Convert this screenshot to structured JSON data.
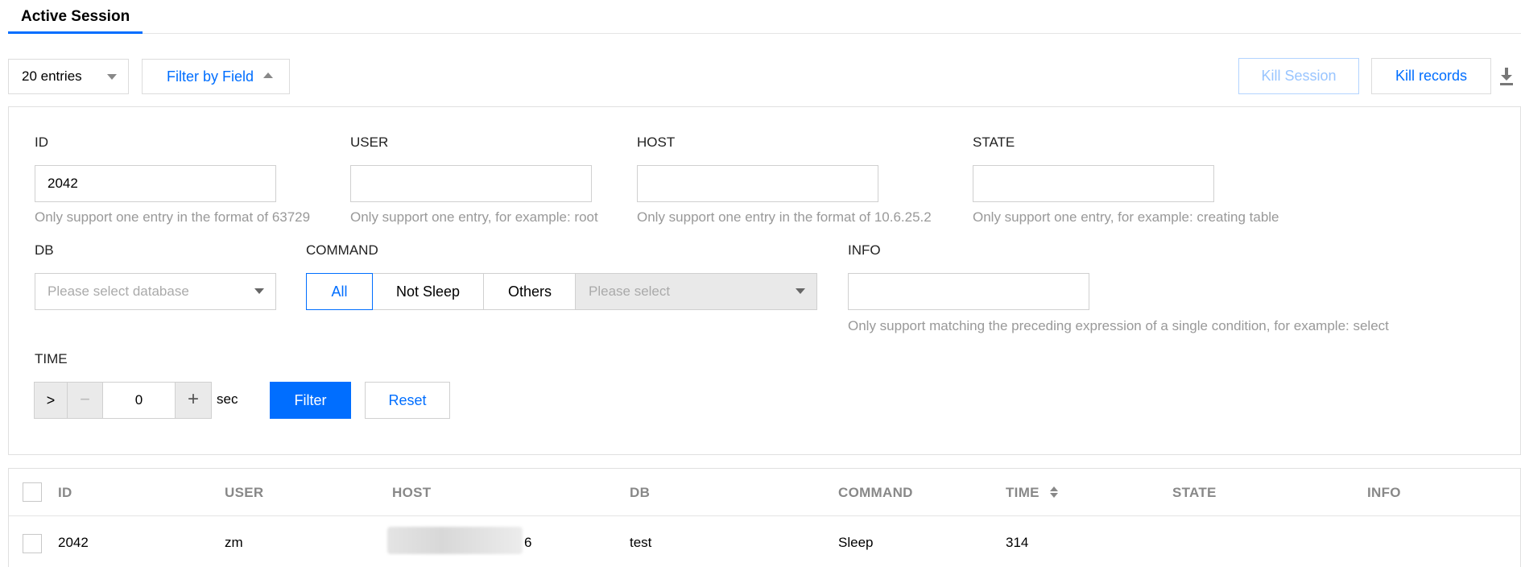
{
  "tabs": {
    "active": "Active Session"
  },
  "toolbar": {
    "entries": "20 entries",
    "filter_toggle": "Filter by Field",
    "kill_session": "Kill Session",
    "kill_records": "Kill records"
  },
  "filter": {
    "id": {
      "label": "ID",
      "value": "2042",
      "hint": "Only support one entry in the format of 63729"
    },
    "user": {
      "label": "USER",
      "value": "",
      "hint": "Only support one entry, for example: root"
    },
    "host": {
      "label": "HOST",
      "value": "",
      "hint": "Only support one entry in the format of 10.6.25.2"
    },
    "state": {
      "label": "STATE",
      "value": "",
      "hint": "Only support one entry, for example: creating table"
    },
    "db": {
      "label": "DB",
      "placeholder": "Please select database"
    },
    "command": {
      "label": "COMMAND",
      "options": [
        "All",
        "Not Sleep",
        "Others"
      ],
      "selected": "All",
      "select_placeholder": "Please select"
    },
    "info": {
      "label": "INFO",
      "value": "",
      "hint": "Only support matching the preceding expression of a single condition, for example: select"
    },
    "time": {
      "label": "TIME",
      "operator": ">",
      "minus": "−",
      "value": "0",
      "plus": "+",
      "unit": "sec"
    },
    "filter_button": "Filter",
    "reset_button": "Reset"
  },
  "table": {
    "columns": [
      "ID",
      "USER",
      "HOST",
      "DB",
      "COMMAND",
      "TIME",
      "STATE",
      "INFO"
    ],
    "rows": [
      {
        "id": "2042",
        "user": "zm",
        "host_visible": "6",
        "db": "test",
        "command": "Sleep",
        "time": "314",
        "state": "",
        "info": ""
      }
    ]
  },
  "colors": {
    "accent": "#006eff",
    "hint": "#999999",
    "border": "#dcdcdc"
  },
  "icons": {
    "download": "download-icon",
    "sort": "sort-icon",
    "dropdown": "chevron-down-icon"
  }
}
